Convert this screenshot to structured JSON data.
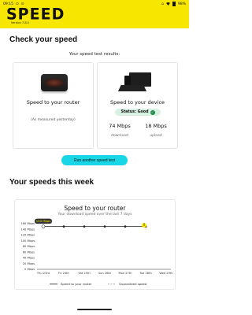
{
  "status_bar": {
    "time": "09:15",
    "battery": "98%"
  },
  "header": {
    "brand": "SPEED",
    "version": "Version 7.8.0"
  },
  "check_section": {
    "title": "Check your speed",
    "results_heading": "Your speed test results:",
    "router_card": {
      "label": "Speed to your router",
      "note": "(As measured yesterday)"
    },
    "device_card": {
      "label": "Speed to your device",
      "status": "Status: Good",
      "download_value": "74 Mbps",
      "download_caption": "download",
      "upload_value": "18 Mbps",
      "upload_caption": "upload"
    },
    "cta_label": "Run another speed test"
  },
  "week_section": {
    "title": "Your speeds this week"
  },
  "chart_data": {
    "type": "line",
    "title": "Speed to your router",
    "subtitle": "Your download speed over the last 7 days",
    "categories": [
      "Thu 23rd",
      "Fri 24th",
      "Sat 25th",
      "Sun 26th",
      "Mon 27th",
      "Tue 28th",
      "Wed 29th"
    ],
    "yticks": [
      "0 Mbps",
      "20 Mbps",
      "40 Mbps",
      "60 Mbps",
      "80 Mbps",
      "100 Mbps",
      "120 Mbps",
      "140 Mbps",
      "160 Mbps"
    ],
    "ylim": [
      0,
      160
    ],
    "series": [
      {
        "name": "Speed to your router",
        "values": [
          150,
          150,
          150,
          150,
          150,
          150,
          null
        ],
        "color": "#222222"
      },
      {
        "name": "Guaranteed speed",
        "values": [
          0,
          0,
          0,
          0,
          0,
          0,
          0
        ],
        "color": "#999999",
        "dashed": true
      }
    ],
    "tooltip": "150 Mbps",
    "warning_icon": "!"
  }
}
